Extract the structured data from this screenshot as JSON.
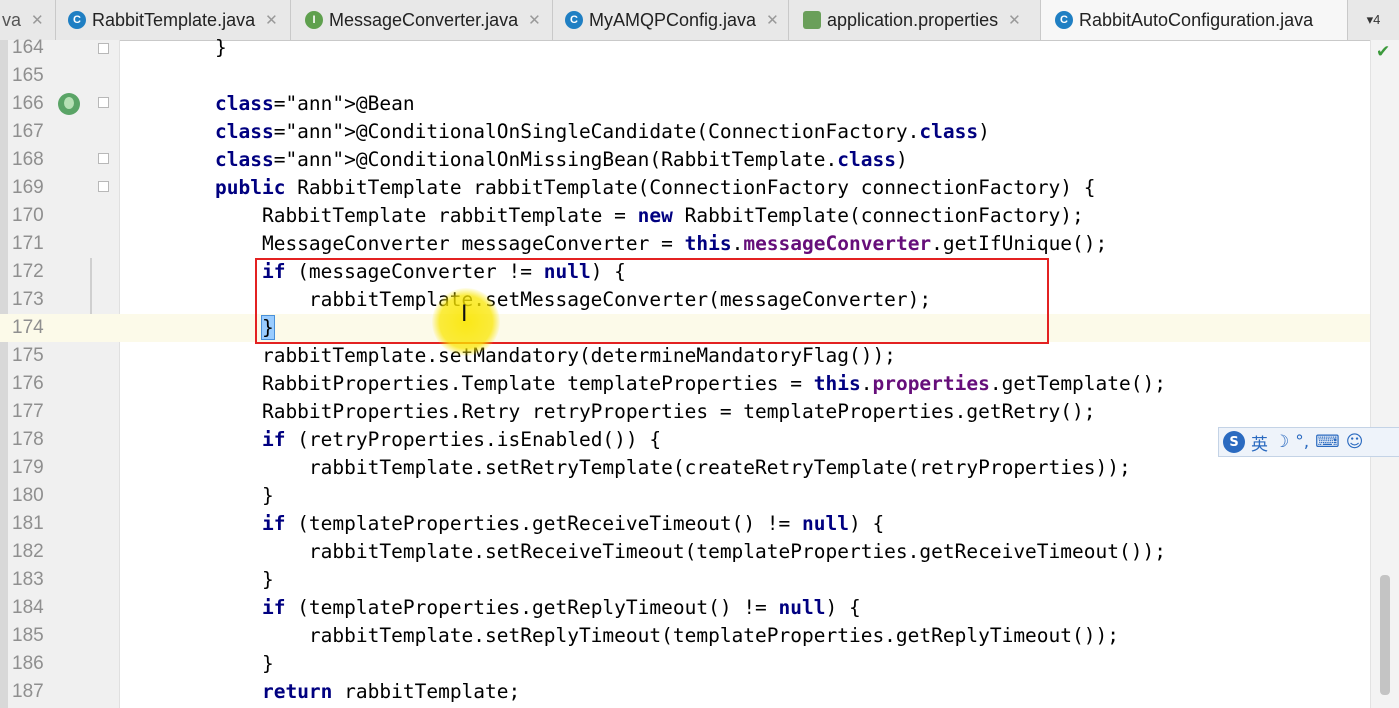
{
  "tabs": [
    {
      "label": "va",
      "icon": "",
      "icon_color": "#1f7fc3",
      "closable": true,
      "active": false
    },
    {
      "label": "RabbitTemplate.java",
      "icon": "C",
      "icon_color": "#1f7fc3",
      "closable": true,
      "active": false
    },
    {
      "label": "MessageConverter.java",
      "icon": "I",
      "icon_color": "#5fa04e",
      "closable": true,
      "active": false
    },
    {
      "label": "MyAMQPConfig.java",
      "icon": "C",
      "icon_color": "#1f7fc3",
      "closable": true,
      "active": false
    },
    {
      "label": "application.properties",
      "icon": "",
      "icon_color": "#6a9f5a",
      "closable": true,
      "active": false
    },
    {
      "label": "RabbitAutoConfiguration.java",
      "icon": "C",
      "icon_color": "#1f7fc3",
      "closable": false,
      "active": true
    }
  ],
  "tab_overflow": "▾4",
  "editor": {
    "lines": [
      {
        "num": "164",
        "code": "}"
      },
      {
        "num": "165",
        "code": ""
      },
      {
        "num": "166",
        "code": "@Bean"
      },
      {
        "num": "167",
        "code": "@ConditionalOnSingleCandidate(ConnectionFactory.class)"
      },
      {
        "num": "168",
        "code": "@ConditionalOnMissingBean(RabbitTemplate.class)"
      },
      {
        "num": "169",
        "code": "public RabbitTemplate rabbitTemplate(ConnectionFactory connectionFactory) {"
      },
      {
        "num": "170",
        "code": "    RabbitTemplate rabbitTemplate = new RabbitTemplate(connectionFactory);"
      },
      {
        "num": "171",
        "code": "    MessageConverter messageConverter = this.messageConverter.getIfUnique();"
      },
      {
        "num": "172",
        "code": "    if (messageConverter != null) {"
      },
      {
        "num": "173",
        "code": "        rabbitTemplate.setMessageConverter(messageConverter);"
      },
      {
        "num": "174",
        "code": "    }"
      },
      {
        "num": "175",
        "code": "    rabbitTemplate.setMandatory(determineMandatoryFlag());"
      },
      {
        "num": "176",
        "code": "    RabbitProperties.Template templateProperties = this.properties.getTemplate();"
      },
      {
        "num": "177",
        "code": "    RabbitProperties.Retry retryProperties = templateProperties.getRetry();"
      },
      {
        "num": "178",
        "code": "    if (retryProperties.isEnabled()) {"
      },
      {
        "num": "179",
        "code": "        rabbitTemplate.setRetryTemplate(createRetryTemplate(retryProperties));"
      },
      {
        "num": "180",
        "code": "    }"
      },
      {
        "num": "181",
        "code": "    if (templateProperties.getReceiveTimeout() != null) {"
      },
      {
        "num": "182",
        "code": "        rabbitTemplate.setReceiveTimeout(templateProperties.getReceiveTimeout());"
      },
      {
        "num": "183",
        "code": "    }"
      },
      {
        "num": "184",
        "code": "    if (templateProperties.getReplyTimeout() != null) {"
      },
      {
        "num": "185",
        "code": "        rabbitTemplate.setReplyTimeout(templateProperties.getReplyTimeout());"
      },
      {
        "num": "186",
        "code": "    }"
      },
      {
        "num": "187",
        "code": "    return rabbitTemplate;"
      }
    ],
    "current_line": "174",
    "colors": {
      "annotation": "#808000",
      "keyword": "#000080",
      "field": "#660e7a",
      "highlight_box": "#e32121",
      "current_line_bg": "#fcfae9"
    }
  },
  "ime": {
    "lang": "英",
    "moon_icon": "☽",
    "punct": "°,",
    "keyboard_icon": "⌨",
    "user_icon": "☺"
  },
  "status": {
    "check_icon": "✔"
  }
}
